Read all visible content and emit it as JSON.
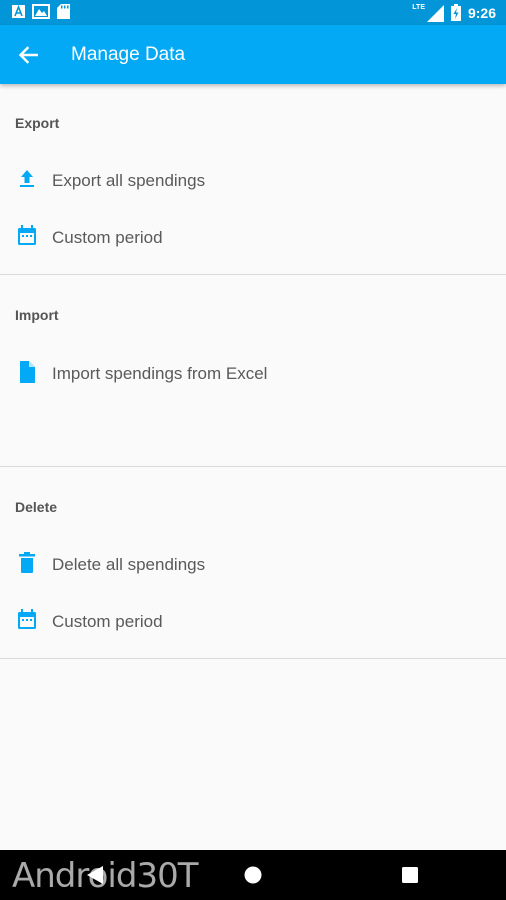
{
  "status_bar": {
    "time": "9:26",
    "network": "LTE"
  },
  "app_bar": {
    "title": "Manage Data",
    "back_icon": "arrow-back-icon"
  },
  "sections": {
    "export": {
      "header": "Export",
      "items": [
        {
          "label": "Export all spendings",
          "icon": "upload-icon"
        },
        {
          "label": "Custom period",
          "icon": "calendar-icon"
        }
      ]
    },
    "import": {
      "header": "Import",
      "items": [
        {
          "label": "Import spendings from Excel",
          "icon": "file-icon"
        }
      ]
    },
    "delete": {
      "header": "Delete",
      "items": [
        {
          "label": "Delete all spendings",
          "icon": "trash-icon"
        },
        {
          "label": "Custom period",
          "icon": "calendar-icon"
        }
      ]
    }
  },
  "watermark": "Android30T",
  "colors": {
    "accent": "#03a9f4",
    "status_bar": "#0296d8",
    "icon": "#03a9f4",
    "text": "#5a5a5a",
    "background": "#fafafa"
  }
}
